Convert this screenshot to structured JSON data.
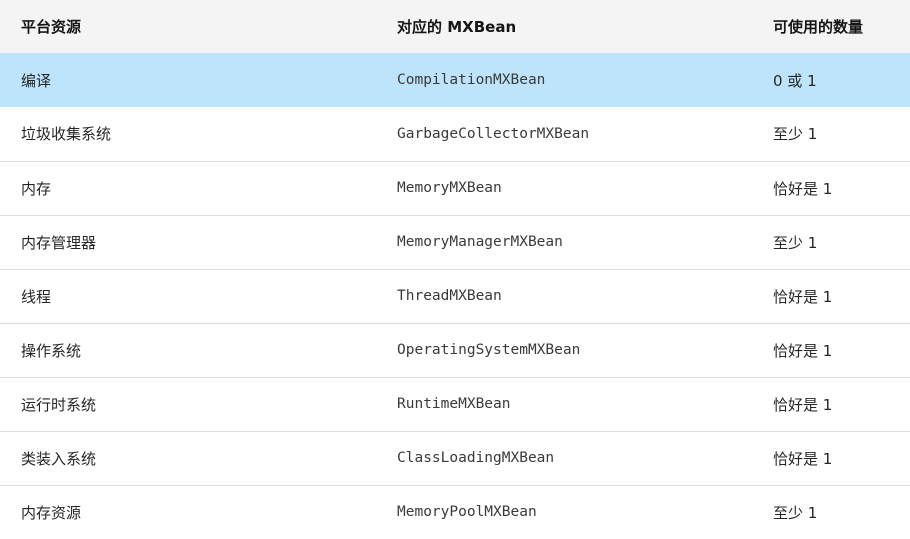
{
  "table": {
    "headers": [
      "平台资源",
      "对应的 MXBean",
      "可使用的数量"
    ],
    "rows": [
      {
        "resource": "编译",
        "mxbean": "CompilationMXBean",
        "count": "0 或 1",
        "selected": true
      },
      {
        "resource": "垃圾收集系统",
        "mxbean": "GarbageCollectorMXBean",
        "count": "至少 1"
      },
      {
        "resource": "内存",
        "mxbean": "MemoryMXBean",
        "count": "恰好是 1"
      },
      {
        "resource": "内存管理器",
        "mxbean": "MemoryManagerMXBean",
        "count": "至少 1"
      },
      {
        "resource": "线程",
        "mxbean": "ThreadMXBean",
        "count": "恰好是 1"
      },
      {
        "resource": "操作系统",
        "mxbean": "OperatingSystemMXBean",
        "count": "恰好是 1"
      },
      {
        "resource": "运行时系统",
        "mxbean": "RuntimeMXBean",
        "count": "恰好是 1"
      },
      {
        "resource": "类装入系统",
        "mxbean": "ClassLoadingMXBean",
        "count": "恰好是 1"
      },
      {
        "resource": "内存资源",
        "mxbean": "MemoryPoolMXBean",
        "count": "至少 1"
      }
    ]
  },
  "colors": {
    "header_bg": "#f4f4f4",
    "selected_row_bg": "#bee4fb",
    "row_divider": "#e0e0e0"
  }
}
